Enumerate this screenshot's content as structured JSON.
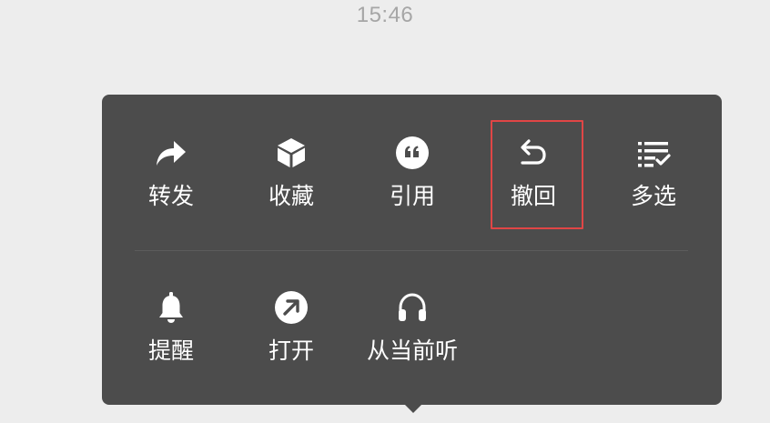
{
  "status": {
    "time": "15:46"
  },
  "menu": {
    "row1": [
      {
        "label": "转发",
        "icon": "forward-arrow-icon"
      },
      {
        "label": "收藏",
        "icon": "cube-favorite-icon"
      },
      {
        "label": "引用",
        "icon": "quote-icon"
      },
      {
        "label": "撤回",
        "icon": "undo-arrow-icon"
      },
      {
        "label": "多选",
        "icon": "multi-select-list-icon"
      }
    ],
    "row2": [
      {
        "label": "提醒",
        "icon": "bell-icon"
      },
      {
        "label": "打开",
        "icon": "open-external-arrow-icon"
      },
      {
        "label": "从当前听",
        "icon": "headphones-icon"
      }
    ]
  },
  "colors": {
    "background": "#ededed",
    "menu": "#4c4c4c",
    "highlight_box": "#e04646",
    "text": "#ffffff"
  }
}
